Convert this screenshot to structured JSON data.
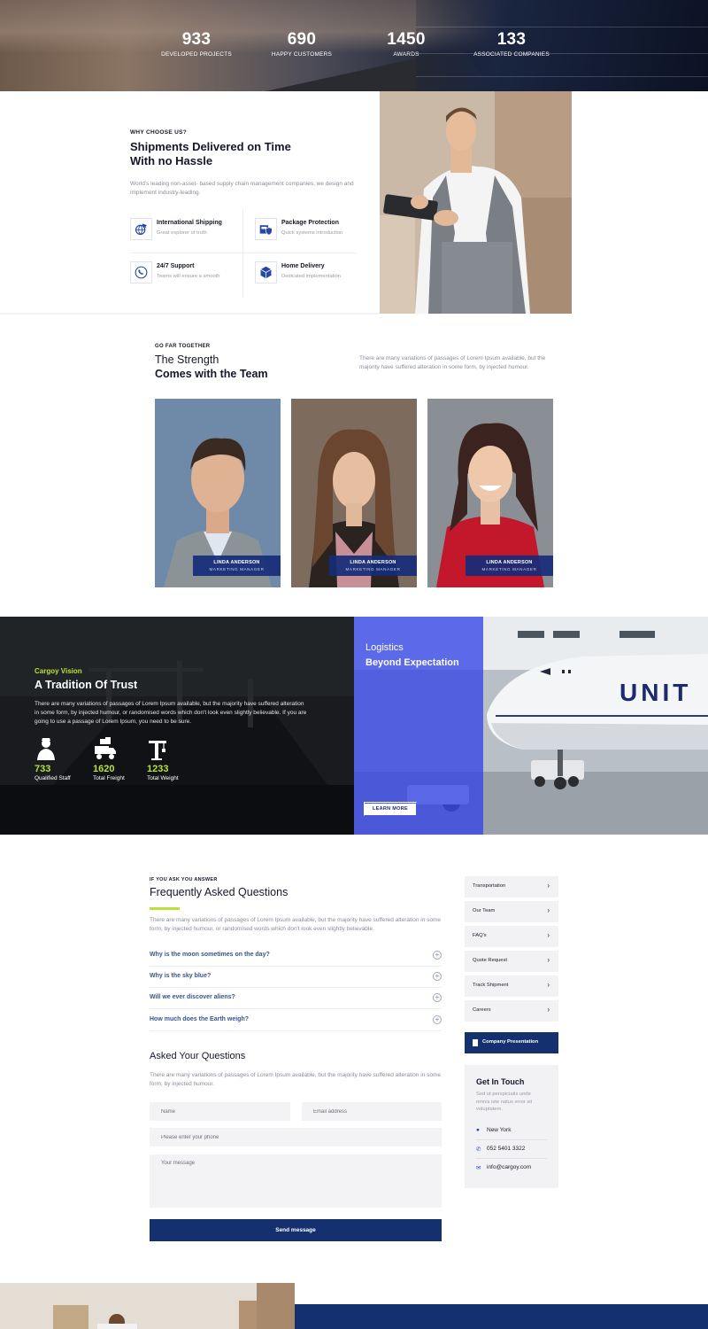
{
  "stats": [
    {
      "value": "933",
      "label": "DEVELOPED PROJECTS"
    },
    {
      "value": "690",
      "label": "HAPPY CUSTOMERS"
    },
    {
      "value": "1450",
      "label": "AWARDS"
    },
    {
      "value": "133",
      "label": "ASSOCIATED COMPANIES"
    }
  ],
  "why": {
    "eyebrow": "WHY CHOOSE US?",
    "title_line1": "Shipments Delivered on Time",
    "title_line2": "With no Hassle",
    "description": "World's leading non-asset- based supply chain management companies, we design and implement industry-leading.",
    "features": [
      {
        "title": "International Shipping",
        "subtitle": "Great explorer of truth",
        "icon": "globe-plane-icon"
      },
      {
        "title": "Package Protection",
        "subtitle": "Quick systems introduction",
        "icon": "package-protection-icon"
      },
      {
        "title": "24/7 Support",
        "subtitle": "Teams will ensure a smooth",
        "icon": "phone-support-icon"
      },
      {
        "title": "Home Delivery",
        "subtitle": "Dedicated implementation",
        "icon": "box-delivery-icon"
      }
    ]
  },
  "team": {
    "eyebrow": "GO FAR TOGETHER",
    "title_line1": "The Strength",
    "title_line2": "Comes with the Team",
    "description": "There are many variations of passages of Lorem Ipsum available, but the majority have suffered alteration in some form, by injected humour.",
    "members": [
      {
        "name": "LINDA ANDERSON",
        "role": "MARKETING MANAGER"
      },
      {
        "name": "LINDA ANDERSON",
        "role": "MARKETING MANAGER"
      },
      {
        "name": "LINDA ANDERSON",
        "role": "MARKETING MANAGER"
      }
    ]
  },
  "vision": {
    "eyebrow": "Cargoy Vision",
    "title": "A Tradition Of Trust",
    "description": "There are many variations of passages of Lorem Ipsum available, but the majority have suffered alteration in some form, by injected humour, or randomised words which don't look even slightly believable. If you are going to use a passage of Lorem Ipsum, you need to be sure.",
    "stats": [
      {
        "value": "733",
        "label": "Qualified Staff",
        "icon": "staff-icon"
      },
      {
        "value": "1620",
        "label": "Total Freight",
        "icon": "freight-truck-icon"
      },
      {
        "value": "1233",
        "label": "Total Weight",
        "icon": "crane-icon"
      }
    ]
  },
  "logistics": {
    "title_line1": "Logistics",
    "title_line2": "Beyond Expectation",
    "button": "LEARN MORE",
    "plane_text": "UNIT"
  },
  "faq": {
    "eyebrow": "IF YOU ASK YOU ANSWER",
    "title": "Frequently Asked Questions",
    "description": "There are many variations of passages of Lorem Ipsum available, but the majority have suffered alteration in some form, by injected humour, or randomised words which don't look even slightly believable.",
    "questions": [
      "Why is the moon sometimes on the day?",
      "Why is the sky blue?",
      "Will we ever discover aliens?",
      "How much does the Earth weigh?"
    ]
  },
  "ask": {
    "title": "Asked Your Questions",
    "description": "There are many variations of passages of Lorem Ipsum available, but the majority have suffered alteration in some form, by injected humour.",
    "name_placeholder": "Name",
    "email_placeholder": "Email address",
    "phone_placeholder": "Please enter your phone",
    "message_placeholder": "Your message",
    "send_label": "Send message"
  },
  "sidebar": {
    "items": [
      "Transportation",
      "Our Team",
      "FAQ's",
      "Quote Request",
      "Track Shipment",
      "Careers"
    ],
    "presentation": "Company Presentation",
    "touch_title": "Get In Touch",
    "touch_desc": "Sed ut perspiciatis unde omnis iste natus error sit voluptatem.",
    "location": "New York",
    "phone": "052 5401 3322",
    "email": "info@cargoy.com"
  },
  "colors": {
    "navy": "#15306e",
    "lime": "#b8e23a",
    "royal_blue": "#3444e6",
    "link_blue": "#37538f"
  }
}
